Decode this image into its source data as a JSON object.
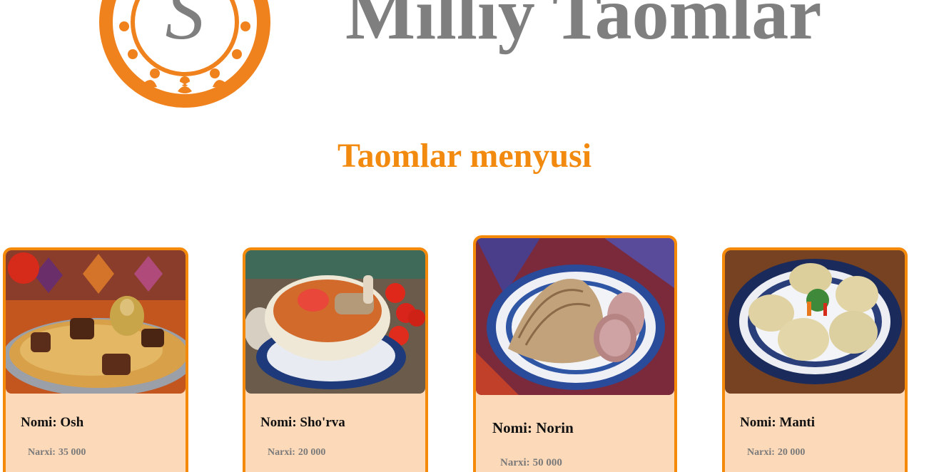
{
  "header": {
    "site_title": "Milliy Taomlar",
    "logo_letter": "S"
  },
  "menu": {
    "heading": "Taomlar menyusi",
    "name_prefix": "Nomi:",
    "price_prefix": "Narxi:",
    "items": [
      {
        "name": "Osh",
        "price": "35 000"
      },
      {
        "name": "Sho'rva",
        "price": "20 000"
      },
      {
        "name": "Norin",
        "price": "50 000"
      },
      {
        "name": "Manti",
        "price": "20 000"
      }
    ]
  },
  "colors": {
    "accent": "#f28a0f",
    "card_border": "#f58a0a",
    "card_bg": "#fcd9b8",
    "title_gray": "#7f7f7f"
  },
  "icons": [
    "logo-emblem",
    "osh-photo",
    "shorva-photo",
    "norin-photo",
    "manti-photo"
  ]
}
